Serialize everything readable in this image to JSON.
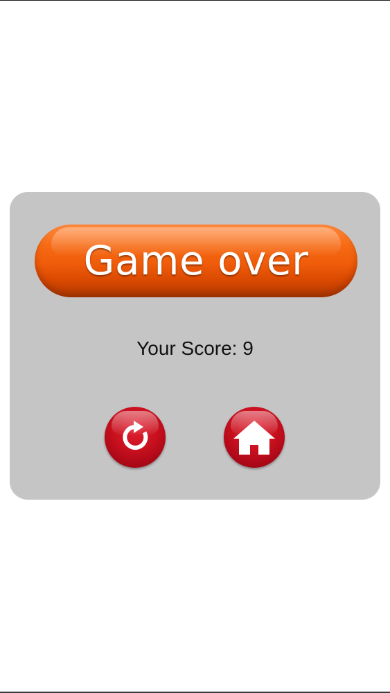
{
  "dialog": {
    "title": "Game over",
    "score_text": "Your Score: 9",
    "buttons": {
      "restart_icon": "restart-icon",
      "home_icon": "home-icon"
    }
  },
  "colors": {
    "dialog_bg": "#c6c5c6",
    "banner_orange": "#ef5b0a",
    "button_red": "#c8101e",
    "icon_white": "#ffffff"
  }
}
